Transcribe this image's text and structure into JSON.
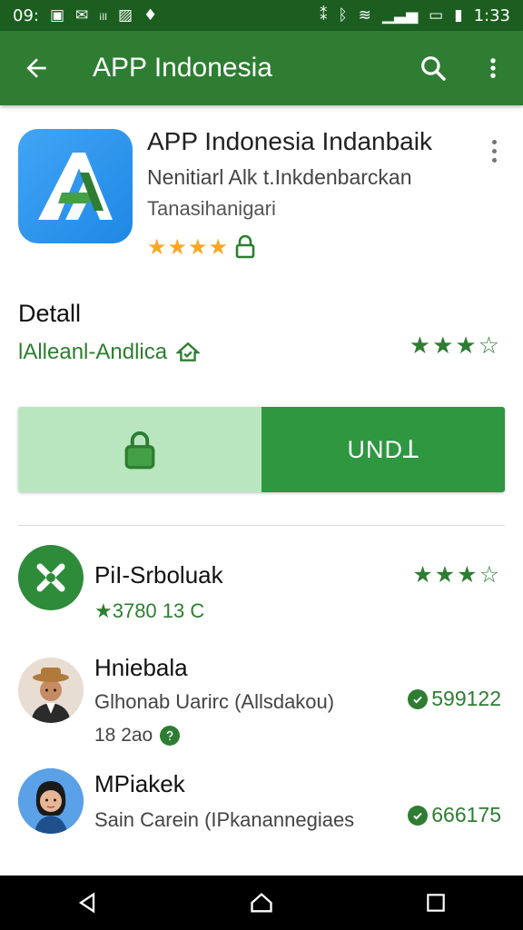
{
  "status_bar": {
    "left_text": "09:",
    "time": "1:33",
    "icons": [
      "notification-icon",
      "mail-icon",
      "signal-text-icon",
      "image-icon",
      "shield-icon",
      "vibrate-icon",
      "bluetooth-icon",
      "wifi-icon",
      "signal-icon",
      "battery-icon",
      "sim-icon"
    ]
  },
  "app_bar": {
    "title": "APP Indonesia",
    "back_icon": "arrow-left-icon",
    "search_icon": "search-icon",
    "menu_icon": "more-vert-icon",
    "color": "#2e7d32"
  },
  "hero": {
    "title": "APP Indonesia Indanbaik",
    "subtitle1": "Nenitiarl Alk t.Inkdenbarckan",
    "subtitle2": "Tanasihanigari",
    "stars": "★★★★",
    "rating_fraction": 0.8,
    "lock_icon": "lock-icon"
  },
  "detail": {
    "heading": "Detall",
    "sub": "lAlleanl-Andlica",
    "sub_icon": "home-badge-icon",
    "rating": "★★★☆",
    "rating_fraction": 0.75
  },
  "actions": {
    "lock_icon": "lock-icon",
    "install_label": "UNDꓕ"
  },
  "list": [
    {
      "title": "PiI-Srboluak",
      "sub": "★3780 13 C",
      "rating": "★★★☆",
      "avatar": "x-logo-icon"
    },
    {
      "title": "Hniebala",
      "sub": "Glhonab Uarirc (Allsdakou)",
      "extra": "18 2ao",
      "count": "599122",
      "avatar": "person-avatar-hat"
    },
    {
      "title": "MPiakek",
      "sub": "Sain Carein (IPkanannegiaes",
      "count": "666175",
      "avatar": "person-avatar-woman"
    }
  ],
  "nav_bar": {
    "back": "nav-back-icon",
    "home": "nav-home-icon",
    "recents": "nav-recents-icon"
  },
  "colors": {
    "primary": "#2e7d32",
    "primary_dark": "#1b5e20",
    "accent_light": "#b9e6bf",
    "star_gold": "#f9a825"
  }
}
